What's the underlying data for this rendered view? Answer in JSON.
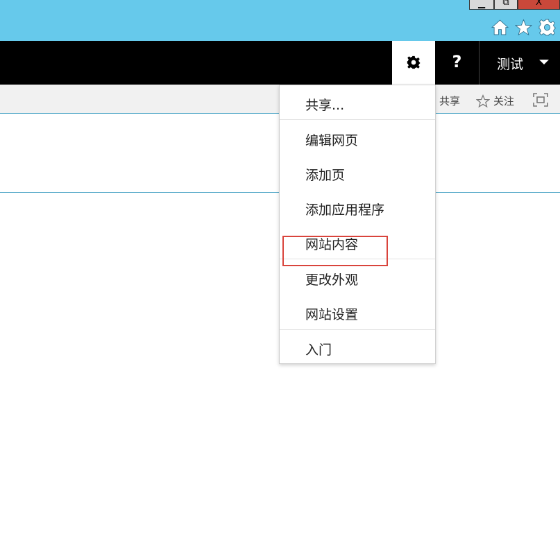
{
  "window_controls": {
    "minimize_glyph": "▁",
    "maximize_glyph": "⧉",
    "close_glyph": "X",
    "close_color": "#c9483a"
  },
  "browser_icons": [
    "home-icon",
    "favorites-star-icon",
    "tools-gear-icon"
  ],
  "suite_bar": {
    "settings_icon": "gear-icon",
    "help_label": "?",
    "user_name": "测试"
  },
  "ribbon": {
    "share_label": "共享",
    "follow_label": "关注",
    "focus_icon": "focus-content-icon"
  },
  "settings_menu": {
    "items": [
      {
        "label": "共享..."
      },
      {
        "label": "编辑网页"
      },
      {
        "label": "添加页"
      },
      {
        "label": "添加应用程序"
      },
      {
        "label": "网站内容"
      },
      {
        "label": "更改外观"
      },
      {
        "label": "网站设置"
      },
      {
        "label": "入门"
      }
    ]
  },
  "colors": {
    "chrome_bar": "#66c9eb",
    "suite_bar": "#000000",
    "highlight_box": "#d9443c",
    "accent_line": "#4da5c6"
  }
}
